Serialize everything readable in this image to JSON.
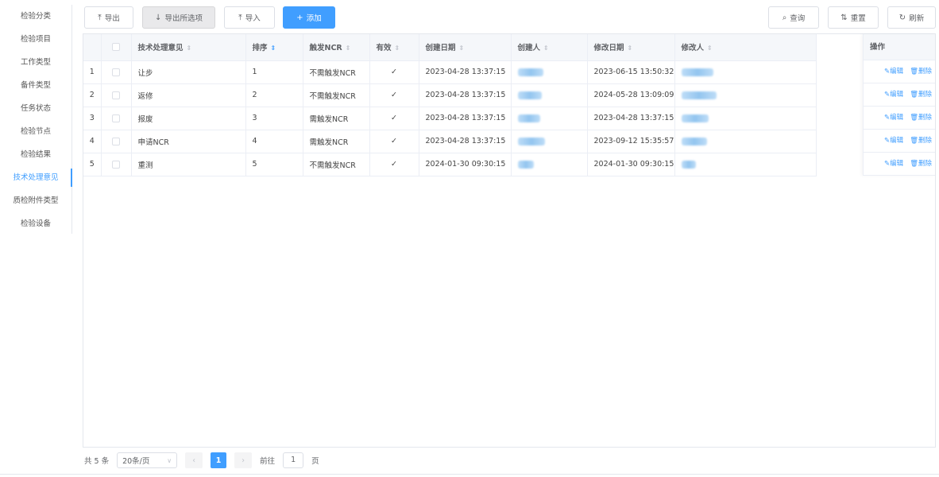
{
  "sidebar": {
    "items": [
      {
        "label": "检验分类"
      },
      {
        "label": "检验项目"
      },
      {
        "label": "工作类型"
      },
      {
        "label": "备件类型"
      },
      {
        "label": "任务状态"
      },
      {
        "label": "检验节点"
      },
      {
        "label": "检验结果"
      },
      {
        "label": "技术处理意见",
        "active": true
      },
      {
        "label": "质检附件类型"
      },
      {
        "label": "检验设备"
      }
    ]
  },
  "toolbar": {
    "export_label": "导出",
    "export_all_label": "导出所选项",
    "import_label": "导入",
    "add_label": "添加",
    "search_label": "查询",
    "reset_label": "重置",
    "refresh_label": "刷新"
  },
  "table": {
    "columns": {
      "tech_opinion": "技术处理意见",
      "sort": "排序",
      "trigger_ncr": "触发NCR",
      "valid": "有效",
      "created_date": "创建日期",
      "creator": "创建人",
      "modified_date": "修改日期",
      "modifier": "修改人",
      "actions": "操作"
    },
    "rows": [
      {
        "index": "1",
        "opinion": "让步",
        "sort": "1",
        "ncr": "不需触发NCR",
        "valid": "✓",
        "created": "2023-04-28 13:37:15",
        "modified": "2023-06-15 13:50:32"
      },
      {
        "index": "2",
        "opinion": "返修",
        "sort": "2",
        "ncr": "不需触发NCR",
        "valid": "✓",
        "created": "2023-04-28 13:37:15",
        "modified": "2024-05-28 13:09:09"
      },
      {
        "index": "3",
        "opinion": "报废",
        "sort": "3",
        "ncr": "需触发NCR",
        "valid": "✓",
        "created": "2023-04-28 13:37:15",
        "modified": "2023-04-28 13:37:15"
      },
      {
        "index": "4",
        "opinion": "申请NCR",
        "sort": "4",
        "ncr": "需触发NCR",
        "valid": "✓",
        "created": "2023-04-28 13:37:15",
        "modified": "2023-09-12 15:35:57"
      },
      {
        "index": "5",
        "opinion": "重测",
        "sort": "5",
        "ncr": "不需触发NCR",
        "valid": "✓",
        "created": "2024-01-30 09:30:15",
        "modified": "2024-01-30 09:30:15"
      }
    ],
    "edit_label": "编辑",
    "delete_label": "删除"
  },
  "pagination": {
    "total_text": "共 5 条",
    "page_size": "20条/页",
    "current_page": "1",
    "goto_prefix": "前往",
    "goto_value": "1",
    "goto_suffix": "页"
  },
  "colors": {
    "accent": "#409eff",
    "header_bg": "#f5f7fa",
    "border": "#ebeef5"
  }
}
